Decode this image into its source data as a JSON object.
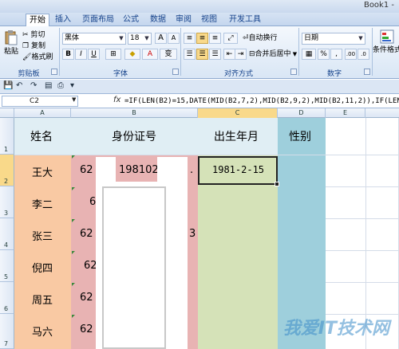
{
  "window": {
    "title": "Book1 -"
  },
  "tabs": [
    {
      "label": "开始",
      "active": true
    },
    {
      "label": "插入"
    },
    {
      "label": "页面布局"
    },
    {
      "label": "公式"
    },
    {
      "label": "数据"
    },
    {
      "label": "审阅"
    },
    {
      "label": "视图"
    },
    {
      "label": "开发工具"
    }
  ],
  "ribbon": {
    "clipboard": {
      "label": "剪贴板",
      "paste": "粘贴",
      "cut": "剪切",
      "copy": "复制",
      "format_painter": "格式刷"
    },
    "font": {
      "label": "字体",
      "font_name": "黑体",
      "font_size": "18",
      "bold": "B",
      "italic": "I",
      "underline": "U",
      "grow": "A",
      "shrink": "A",
      "font_color_glyph": "A",
      "pinyin": "变"
    },
    "alignment": {
      "label": "对齐方式",
      "wrap_text": "自动换行",
      "merge_center": "合并后居中"
    },
    "number": {
      "label": "数字",
      "format": "日期",
      "percent": "%",
      "comma": ",",
      "inc_decimal": ".00",
      "dec_decimal": ".0"
    },
    "styles": {
      "conditional_format": "条件格式"
    }
  },
  "formula_bar": {
    "name_box": "C2",
    "fx": "fx",
    "formula": "=IF(LEN(B2)=15,DATE(MID(B2,7,2),MID(B2,9,2),MID(B2,11,2)),IF(LEN(B2"
  },
  "columns": [
    "A",
    "B",
    "C",
    "D",
    "E"
  ],
  "rows": [
    "1",
    "2",
    "3",
    "4",
    "5",
    "6",
    "7"
  ],
  "sheet": {
    "headers": [
      "姓名",
      "身份证号",
      "出生年月",
      "性别"
    ],
    "names": [
      "王大",
      "李二",
      "张三",
      "倪四",
      "周五",
      "马六"
    ],
    "id_visible": [
      {
        "left": "62",
        "mid": "198102",
        "right": "."
      },
      {
        "left": "6",
        "mid": "",
        "right": ""
      },
      {
        "left": "62",
        "mid": "",
        "right": "3"
      },
      {
        "left": "62",
        "mid": "",
        "right": ""
      },
      {
        "left": "62",
        "mid": "",
        "right": ""
      },
      {
        "left": "62",
        "mid": "",
        "right": ""
      }
    ],
    "birth_dates": [
      "1981-2-15"
    ],
    "colors": {
      "name_col": "#f9c9a3",
      "id_col": "#e8b3b3",
      "birth_col": "#d5e2b8",
      "gender_col": "#9ecfdc",
      "header_row": "#e0eef4"
    }
  },
  "watermark": "我爱IT技术网"
}
